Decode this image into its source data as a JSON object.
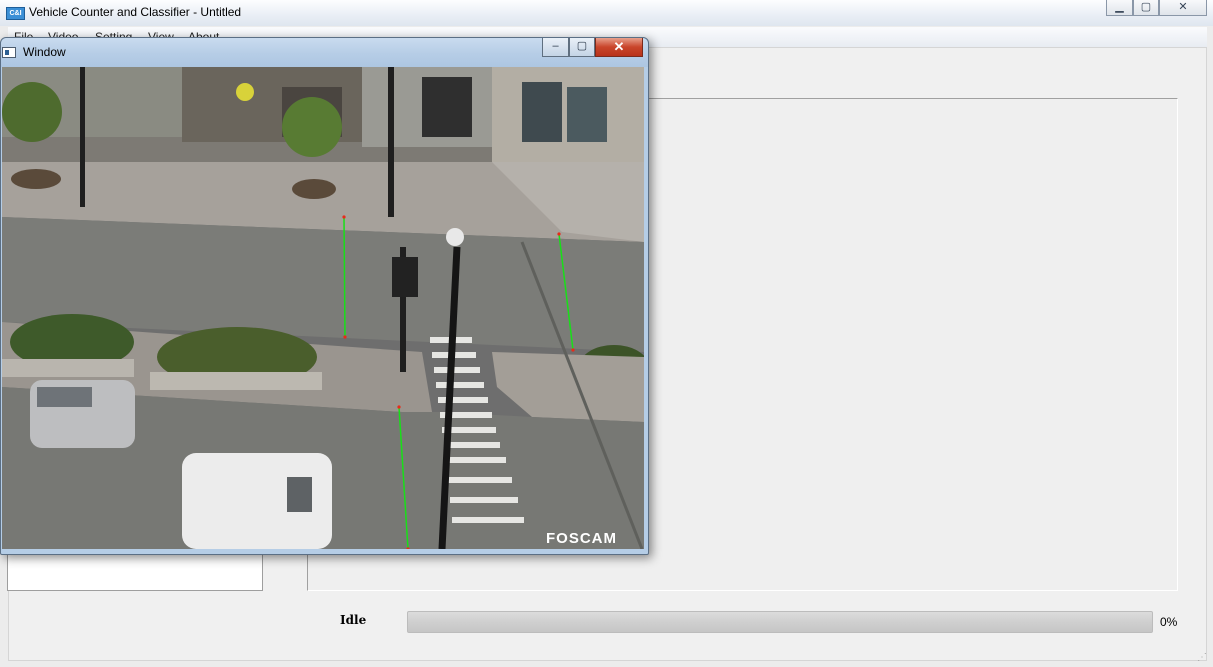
{
  "app": {
    "title": "Vehicle Counter and Classifier - Untitled",
    "icon_text": "C&I",
    "minimize": "▭",
    "maximize": "▢",
    "close": "✕"
  },
  "menu": [
    "File",
    "Video",
    "Setting",
    "View",
    "About"
  ],
  "status": {
    "label": "Idle",
    "progress_text": "0%",
    "progress_value": 0
  },
  "video_window": {
    "title": "Window",
    "minimize": "–",
    "maximize": "▢",
    "close": "✕",
    "watermark": "FOSCAM"
  },
  "colors": {
    "counting_line": "#18e018",
    "line_endpoint": "#e82b1a",
    "progress_fill": "#37b44a"
  }
}
